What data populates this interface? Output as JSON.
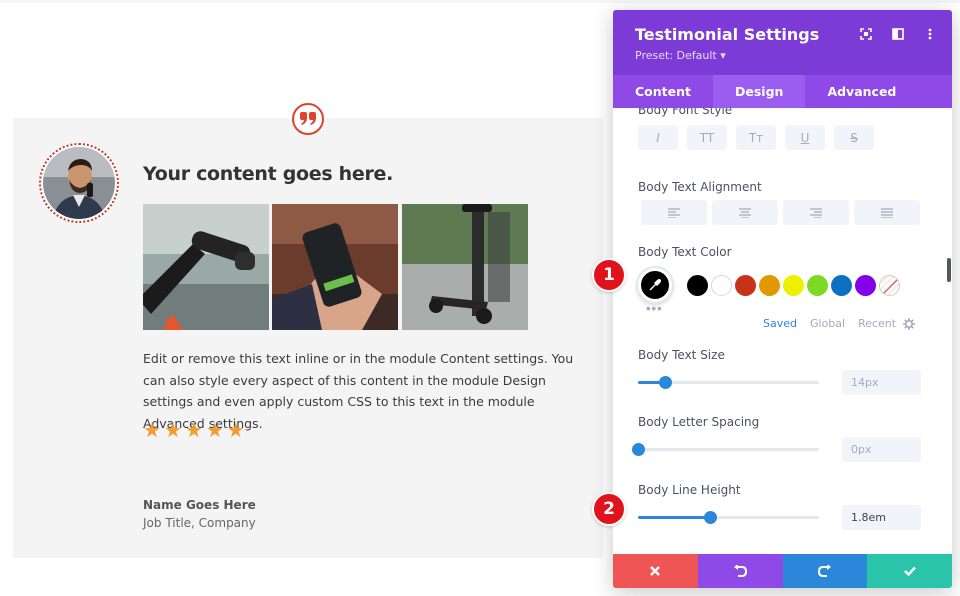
{
  "testimonial": {
    "title": "Your content goes here.",
    "body": "Edit or remove this text inline or in the module Content settings. You can also style every aspect of this content in the module Design settings and even apply custom CSS to this text in the module Advanced settings.",
    "rating": 5,
    "stars": [
      "★",
      "★",
      "★",
      "★",
      "★"
    ],
    "name": "Name Goes Here",
    "job": "Job Title, Company",
    "quote_icon": "quote-icon",
    "images": [
      "scooter-handlebar-photo",
      "phone-in-hand-photo",
      "electric-scooter-photo"
    ]
  },
  "panel": {
    "title": "Testimonial Settings",
    "preset": "Preset: Default ▾",
    "header_icons": [
      "expand-icon",
      "sidebar-icon",
      "more-icon"
    ],
    "tabs": [
      {
        "label": "Content",
        "active": false
      },
      {
        "label": "Design",
        "active": true
      },
      {
        "label": "Advanced",
        "active": false
      }
    ],
    "font_style": {
      "label": "Body Font Style",
      "options": [
        "I",
        "TT",
        "Tт",
        "U",
        "S"
      ]
    },
    "alignment": {
      "label": "Body Text Alignment",
      "options": [
        "align-left-icon",
        "align-center-icon",
        "align-right-icon",
        "align-justify-icon"
      ]
    },
    "text_color": {
      "label": "Body Text Color",
      "selected": "#000000",
      "swatches": [
        "#000000",
        "#ffffff",
        "#c7321b",
        "#e09900",
        "#edf000",
        "#7cda24",
        "#0c71c3",
        "#8300e9",
        "none"
      ],
      "more": "•••",
      "tabs": [
        {
          "label": "Saved",
          "active": true
        },
        {
          "label": "Global",
          "active": false
        },
        {
          "label": "Recent",
          "active": false
        }
      ]
    },
    "text_size": {
      "label": "Body Text Size",
      "value": "14px",
      "fraction": 0.15
    },
    "letter_spacing": {
      "label": "Body Letter Spacing",
      "value": "0px",
      "fraction": 0.0
    },
    "line_height": {
      "label": "Body Line Height",
      "value": "1.8em",
      "fraction": 0.4
    },
    "footer": [
      {
        "name": "discard-button",
        "icon": "close-icon",
        "color": "#ef5555"
      },
      {
        "name": "undo-button",
        "icon": "undo-icon",
        "color": "#8e49e6"
      },
      {
        "name": "redo-button",
        "icon": "redo-icon",
        "color": "#2b87da"
      },
      {
        "name": "save-button",
        "icon": "check-icon",
        "color": "#29c4a9"
      }
    ]
  },
  "callouts": [
    "1",
    "2"
  ],
  "colors": {
    "panel_header": "#7c3ad6",
    "panel_tabs": "#8e49e6",
    "accent_blue": "#2b87da",
    "star": "#f39c34",
    "callout": "#e0121b"
  }
}
